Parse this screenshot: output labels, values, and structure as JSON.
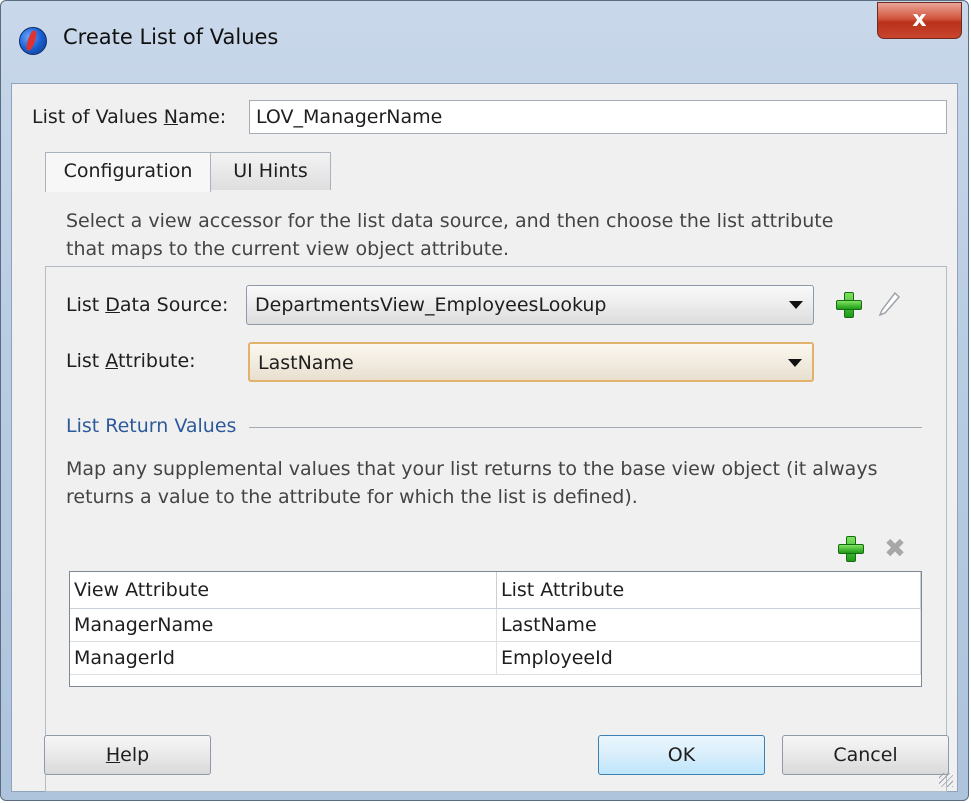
{
  "window": {
    "title": "Create List of Values",
    "close_label": "x"
  },
  "lov_name": {
    "label_pre": "List of Values ",
    "label_mnemonic": "N",
    "label_post": "ame:",
    "value": "LOV_ManagerName"
  },
  "tabs": [
    {
      "label": "Configuration",
      "active": true
    },
    {
      "label": "UI Hints",
      "active": false
    }
  ],
  "config": {
    "description_line1": "Select a view accessor for the list data source, and then choose the list attribute",
    "description_line2": "that maps to the current view object attribute.",
    "data_source": {
      "label_pre": "List ",
      "label_mnemonic": "D",
      "label_post": "ata Source:",
      "value": "DepartmentsView_EmployeesLookup"
    },
    "list_attribute": {
      "label_pre": "List ",
      "label_mnemonic": "A",
      "label_post": "ttribute:",
      "value": "LastName"
    }
  },
  "return_values": {
    "section_title": "List Return Values",
    "description_line1": "Map any supplemental values that your list returns to the base view object (it always",
    "description_line2": "returns a value to the attribute for which the list is defined).",
    "columns": [
      "View Attribute",
      "List Attribute"
    ],
    "rows": [
      [
        "ManagerName",
        "LastName"
      ],
      [
        "ManagerId",
        "EmployeeId"
      ]
    ]
  },
  "buttons": {
    "help_mnemonic": "H",
    "help_rest": "elp",
    "ok": "OK",
    "cancel": "Cancel"
  },
  "icons": {
    "add_data_source": "plus-icon",
    "edit_data_source": "pencil-icon",
    "add_return_value": "plus-icon",
    "delete_return_value": "delete-icon"
  },
  "colors": {
    "titlebar": "#b9cde3",
    "close_button": "#c8452c",
    "section_title": "#2d5a9a",
    "focus_border": "#e1b26b",
    "add_icon": "#1d9b18"
  }
}
